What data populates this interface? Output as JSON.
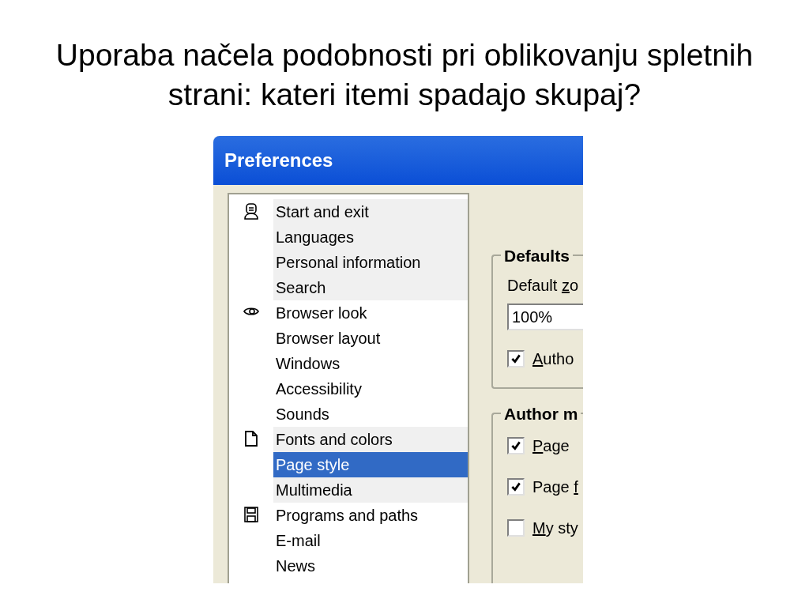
{
  "slide": {
    "title": "Uporaba načela podobnosti pri oblikovanju spletnih strani: kateri itemi spadajo skupaj?"
  },
  "window": {
    "title": "Preferences"
  },
  "category_groups": [
    {
      "shaded": true,
      "items": [
        {
          "label": "Start and exit",
          "selected": false
        },
        {
          "label": "Languages",
          "selected": false
        },
        {
          "label": "Personal information",
          "selected": false
        },
        {
          "label": "Search",
          "selected": false
        }
      ]
    },
    {
      "shaded": false,
      "items": [
        {
          "label": "Browser look",
          "selected": false
        },
        {
          "label": "Browser layout",
          "selected": false
        },
        {
          "label": "Windows",
          "selected": false
        },
        {
          "label": "Accessibility",
          "selected": false
        },
        {
          "label": "Sounds",
          "selected": false
        }
      ]
    },
    {
      "shaded": true,
      "items": [
        {
          "label": "Fonts and colors",
          "selected": false
        },
        {
          "label": "Page style",
          "selected": true
        },
        {
          "label": "Multimedia",
          "selected": false
        }
      ]
    },
    {
      "shaded": false,
      "items": [
        {
          "label": "Programs and paths",
          "selected": false
        },
        {
          "label": "E-mail",
          "selected": false
        },
        {
          "label": "News",
          "selected": false
        }
      ]
    }
  ],
  "defaults_group": {
    "title": "Defaults",
    "zoom_label": {
      "pre": "Default ",
      "key": "z",
      "post": "o"
    },
    "zoom_value": "100%",
    "checkbox": {
      "label": {
        "key": "A",
        "post": "utho"
      },
      "checked": true
    }
  },
  "author_mode_group": {
    "title": "Author m",
    "checkboxes": [
      {
        "label": {
          "key": "P",
          "post": "age"
        },
        "checked": true
      },
      {
        "label": {
          "pre": "Page ",
          "key": "f"
        },
        "checked": true
      },
      {
        "label": {
          "key": "M",
          "post": "y sty"
        },
        "checked": false
      }
    ]
  }
}
